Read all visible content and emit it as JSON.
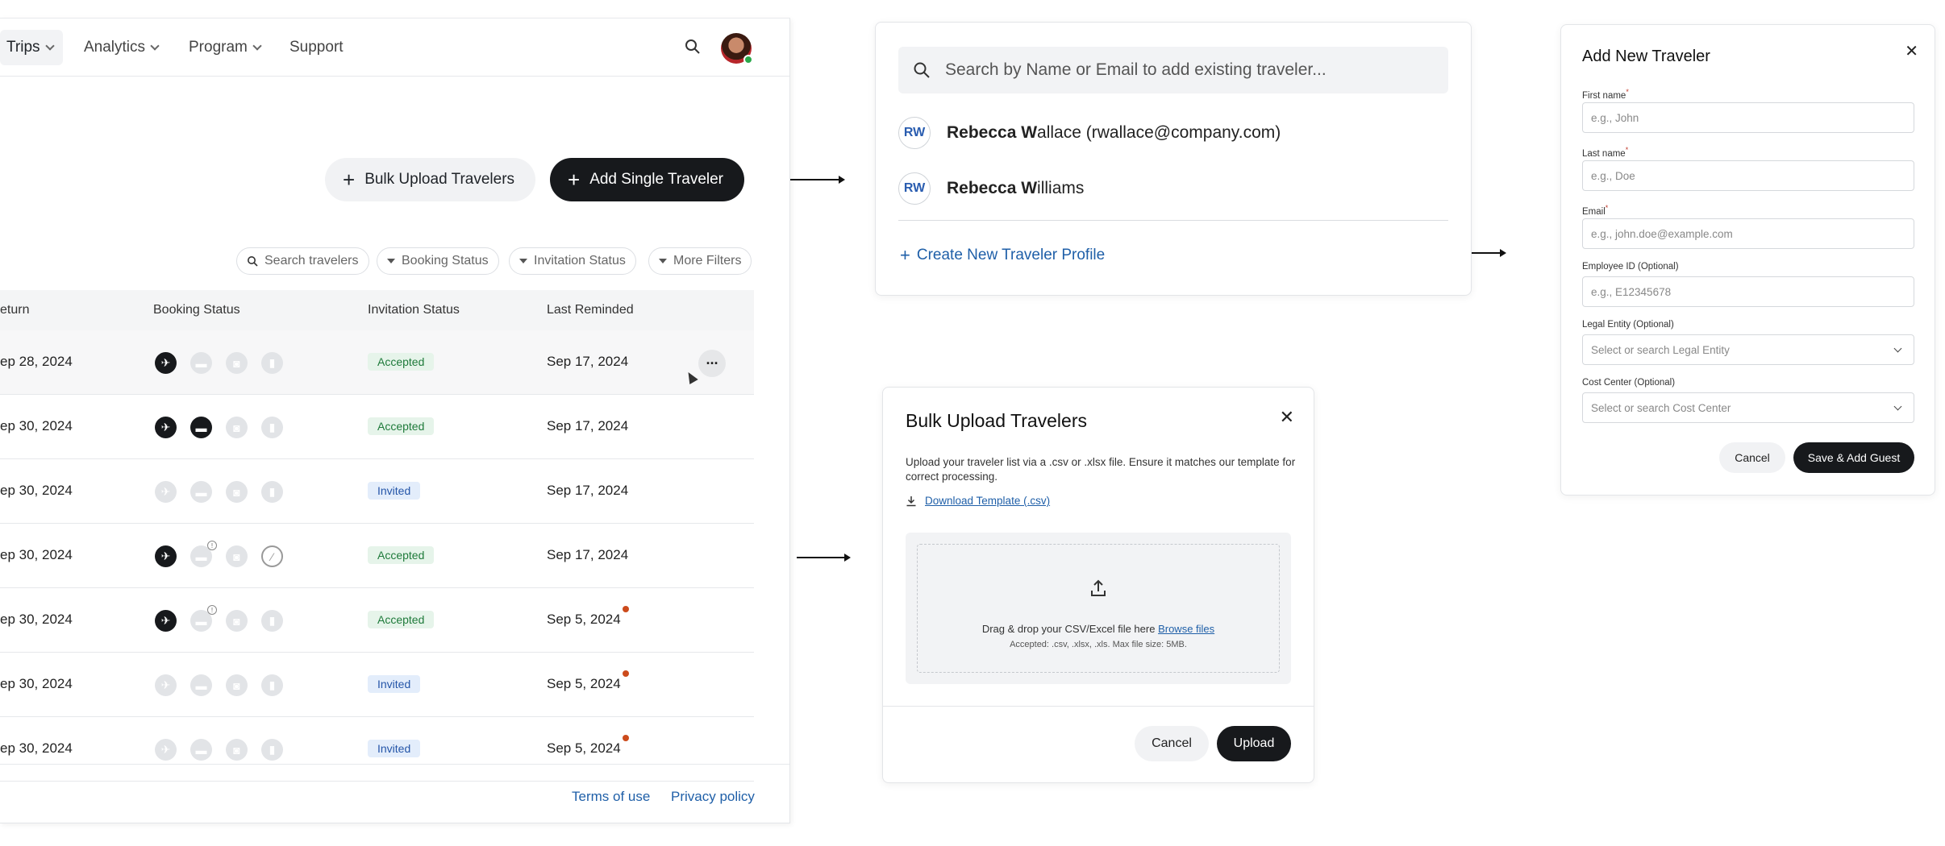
{
  "nav": {
    "items": [
      {
        "label": "Trips",
        "active": true,
        "dropdown": true
      },
      {
        "label": "Analytics",
        "active": false,
        "dropdown": true
      },
      {
        "label": "Program",
        "active": false,
        "dropdown": true
      },
      {
        "label": "Support",
        "active": false,
        "dropdown": false
      }
    ]
  },
  "actions": {
    "bulk_upload": "Bulk Upload Travelers",
    "add_single": "Add Single Traveler"
  },
  "filters": {
    "search_placeholder": "Search travelers",
    "booking_status": "Booking Status",
    "invitation_status": "Invitation Status",
    "more_filters": "More Filters"
  },
  "table": {
    "columns": [
      "eturn",
      "Booking Status",
      "Invitation Status",
      "Last Reminded"
    ],
    "rows": [
      {
        "return": "ep 28, 2024",
        "icons": [
          "plane-on",
          "hotel-off",
          "car-off",
          "rail-off"
        ],
        "invitation": "Accepted",
        "reminded": "Sep 17, 2024",
        "dot": false,
        "highlight": true
      },
      {
        "return": "ep 30, 2024",
        "icons": [
          "plane-on",
          "hotel-on",
          "car-off",
          "rail-off"
        ],
        "invitation": "Accepted",
        "reminded": "Sep 17, 2024",
        "dot": false,
        "highlight": false
      },
      {
        "return": "ep 30, 2024",
        "icons": [
          "plane-off",
          "hotel-off",
          "car-off",
          "rail-off"
        ],
        "invitation": "Invited",
        "reminded": "Sep 17, 2024",
        "dot": false,
        "highlight": false
      },
      {
        "return": "ep 30, 2024",
        "icons": [
          "plane-on",
          "hotel-off-info",
          "car-off",
          "rail-cross"
        ],
        "invitation": "Accepted",
        "reminded": "Sep 17, 2024",
        "dot": false,
        "highlight": false
      },
      {
        "return": "ep 30, 2024",
        "icons": [
          "plane-on",
          "hotel-off-info",
          "car-off",
          "rail-off"
        ],
        "invitation": "Accepted",
        "reminded": "Sep 5, 2024",
        "dot": true,
        "highlight": false
      },
      {
        "return": "ep 30, 2024",
        "icons": [
          "plane-off",
          "hotel-off",
          "car-off",
          "rail-off"
        ],
        "invitation": "Invited",
        "reminded": "Sep 5, 2024",
        "dot": true,
        "highlight": false
      },
      {
        "return": "ep 30, 2024",
        "icons": [
          "plane-off",
          "hotel-off",
          "car-off",
          "rail-off"
        ],
        "invitation": "Invited",
        "reminded": "Sep 5, 2024",
        "dot": true,
        "highlight": false
      }
    ]
  },
  "footer": {
    "terms": "Terms of use",
    "privacy": "Privacy policy"
  },
  "search_popover": {
    "placeholder": "Search by Name or Email to add existing traveler...",
    "results": [
      {
        "initials": "RW",
        "bold": "Rebecca W",
        "rest": "allace (rwallace@company.com)"
      },
      {
        "initials": "RW",
        "bold": "Rebecca W",
        "rest": "illiams"
      }
    ],
    "create_label": "Create New Traveler Profile"
  },
  "bulk_modal": {
    "title": "Bulk Upload Travelers",
    "description": "Upload your traveler list via a .csv or .xlsx file. Ensure it matches our template for correct processing.",
    "download_label": "Download Template (.csv)",
    "drop_text": "Drag & drop your CSV/Excel file here",
    "browse_label": "Browse files",
    "accepted_text": "Accepted: .csv, .xlsx, .xls. Max file size: 5MB.",
    "cancel_label": "Cancel",
    "upload_label": "Upload"
  },
  "add_traveler": {
    "title": "Add New Traveler",
    "fields": [
      {
        "label": "First name",
        "required": true,
        "placeholder": "e.g., John",
        "type": "input"
      },
      {
        "label": "Last name",
        "required": true,
        "placeholder": "e.g., Doe",
        "type": "input"
      },
      {
        "label": "Email",
        "required": true,
        "placeholder": "e.g., john.doe@example.com",
        "type": "input"
      },
      {
        "label": "Employee ID (Optional)",
        "required": false,
        "placeholder": "e.g., E12345678",
        "type": "input"
      },
      {
        "label": "Legal Entity (Optional)",
        "required": false,
        "placeholder": "Select or search Legal Entity",
        "type": "select"
      },
      {
        "label": "Cost Center (Optional)",
        "required": false,
        "placeholder": "Select or search Cost Center",
        "type": "select"
      }
    ],
    "cancel_label": "Cancel",
    "save_label": "Save & Add Guest"
  },
  "colors": {
    "primary_dark": "#17191c",
    "link": "#1f5fa8",
    "accepted_bg": "#e6f4ea",
    "accepted_text": "#1e7a3a",
    "invited_bg": "#e3edfb",
    "invited_text": "#2455a8",
    "reminder_dot": "#cc4b1c"
  }
}
